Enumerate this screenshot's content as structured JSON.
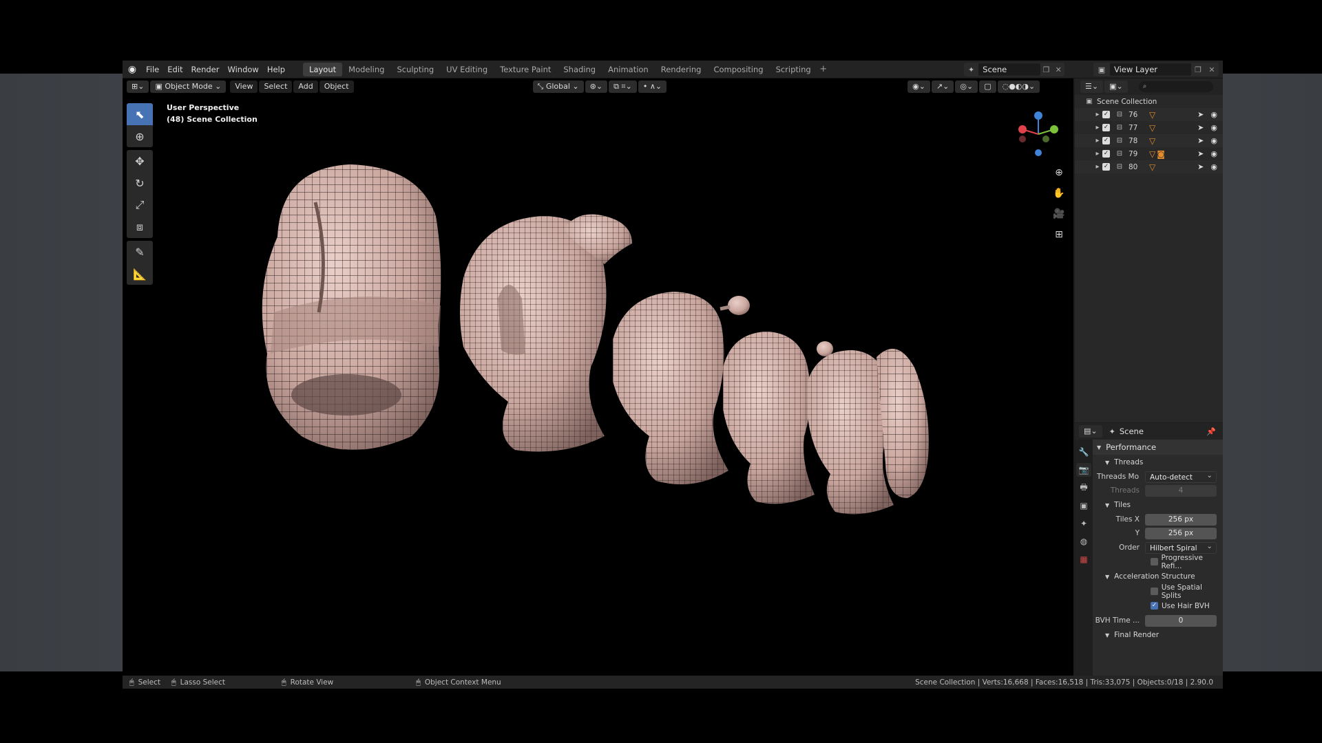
{
  "menus": [
    "File",
    "Edit",
    "Render",
    "Window",
    "Help"
  ],
  "workspaces": [
    "Layout",
    "Modeling",
    "Sculpting",
    "UV Editing",
    "Texture Paint",
    "Shading",
    "Animation",
    "Rendering",
    "Compositing",
    "Scripting"
  ],
  "active_workspace": "Layout",
  "scene_name": "Scene",
  "view_layer_name": "View Layer",
  "viewport": {
    "mode": "Object Mode",
    "menus": [
      "View",
      "Select",
      "Add",
      "Object"
    ],
    "orientation": "Global",
    "info_line1": "User Perspective",
    "info_line2": "(48) Scene Collection"
  },
  "gizmo": {
    "x_color": "#e2434b",
    "y_color": "#7cc33a",
    "z_color": "#3f84d8"
  },
  "outliner": {
    "root": "Scene Collection",
    "items": [
      "76",
      "77",
      "78",
      "79",
      "80"
    ]
  },
  "properties": {
    "header": "Scene",
    "panel": "Performance",
    "threads_header": "Threads",
    "threads_mode_label": "Threads Mo",
    "threads_mode_value": "Auto-detect",
    "threads_label": "Threads",
    "threads_value": "4",
    "tiles_header": "Tiles",
    "tiles_x_label": "Tiles X",
    "tiles_x_value": "256 px",
    "tiles_y_label": "Y",
    "tiles_y_value": "256 px",
    "order_label": "Order",
    "order_value": "Hilbert Spiral",
    "progressive": "Progressive Refi...",
    "accel_header": "Acceleration Structure",
    "spatial_splits": "Use Spatial Splits",
    "hair_bvh": "Use Hair BVH",
    "bvh_time_label": "BVH Time ...",
    "bvh_time_value": "0",
    "final_render_header": "Final Render"
  },
  "statusbar": {
    "select": "Select",
    "lasso": "Lasso Select",
    "rotate": "Rotate View",
    "context": "Object Context Menu",
    "stats": "Scene Collection | Verts:16,668 | Faces:16,518 | Tris:33,075 | Objects:0/18 | 2.90.0"
  }
}
